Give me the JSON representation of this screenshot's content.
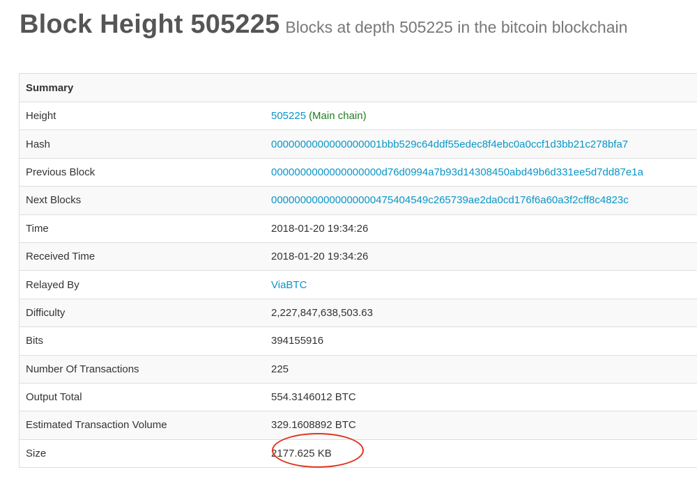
{
  "header": {
    "title": "Block Height 505225",
    "subtitle": "Blocks at depth 505225 in the bitcoin blockchain"
  },
  "summary": {
    "heading": "Summary",
    "rows": [
      {
        "label": "Height",
        "value": "505225",
        "suffix": "(Main chain)",
        "link": true
      },
      {
        "label": "Hash",
        "value": "0000000000000000001bbb529c64ddf55edec8f4ebc0a0ccf1d3bb21c278bfa7",
        "link": true
      },
      {
        "label": "Previous Block",
        "value": "0000000000000000000d76d0994a7b93d14308450abd49b6d331ee5d7dd87e1a",
        "link": true
      },
      {
        "label": "Next Blocks",
        "value": "000000000000000000475404549c265739ae2da0cd176f6a60a3f2cff8c4823c",
        "link": true
      },
      {
        "label": "Time",
        "value": "2018-01-20 19:34:26",
        "link": false
      },
      {
        "label": "Received Time",
        "value": "2018-01-20 19:34:26",
        "link": false
      },
      {
        "label": "Relayed By",
        "value": "ViaBTC",
        "link": true
      },
      {
        "label": "Difficulty",
        "value": "2,227,847,638,503.63",
        "link": false
      },
      {
        "label": "Bits",
        "value": "394155916",
        "link": false
      },
      {
        "label": "Number Of Transactions",
        "value": "225",
        "link": false
      },
      {
        "label": "Output Total",
        "value": "554.3146012 BTC",
        "link": false
      },
      {
        "label": "Estimated Transaction Volume",
        "value": "329.1608892 BTC",
        "link": false
      },
      {
        "label": "Size",
        "value": "2177.625 KB",
        "link": false
      }
    ]
  },
  "colors": {
    "link": "#0a95c6",
    "main_chain": "#1e7e1e",
    "annotation_circle": "#e0321e"
  }
}
